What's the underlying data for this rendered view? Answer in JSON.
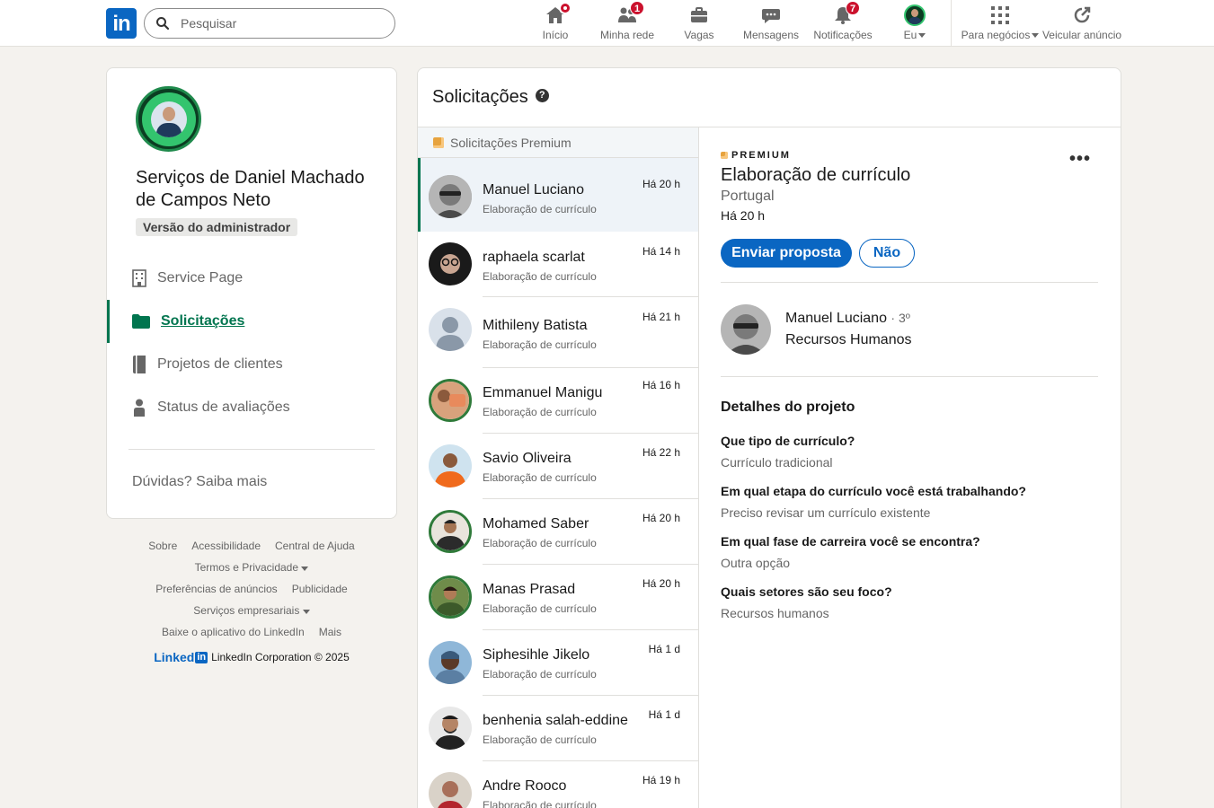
{
  "nav": {
    "search_placeholder": "Pesquisar",
    "items": [
      {
        "label": "Início",
        "icon": "home-icon",
        "badge": ""
      },
      {
        "label": "Minha rede",
        "icon": "network-icon",
        "badge": "1"
      },
      {
        "label": "Vagas",
        "icon": "briefcase-icon",
        "badge": ""
      },
      {
        "label": "Mensagens",
        "icon": "messaging-icon",
        "badge": ""
      },
      {
        "label": "Notificações",
        "icon": "bell-icon",
        "badge": "7"
      },
      {
        "label": "Eu",
        "icon": "avatar-icon",
        "badge": ""
      },
      {
        "label": "Para negócios",
        "icon": "grid-icon",
        "badge": ""
      },
      {
        "label": "Veicular anúncio",
        "icon": "ad-icon",
        "badge": ""
      }
    ],
    "logo_text": "in"
  },
  "sidebar": {
    "company_name": "Serviços de Daniel Machado de Campos Neto",
    "admin_tag": "Versão do administrador",
    "items": [
      {
        "label": "Service Page",
        "icon": "building-icon"
      },
      {
        "label": "Solicitações",
        "icon": "folder-icon"
      },
      {
        "label": "Projetos de clientes",
        "icon": "book-icon"
      },
      {
        "label": "Status de avaliações",
        "icon": "person-icon"
      }
    ],
    "help_link": "Dúvidas? Saiba mais"
  },
  "footer": {
    "links": [
      "Sobre",
      "Acessibilidade",
      "Central de Ajuda",
      "Termos e Privacidade",
      "Preferências de anúncios",
      "Publicidade",
      "Serviços empresariais",
      "Baixe o aplicativo do LinkedIn",
      "Mais"
    ],
    "brand": "Linked",
    "brand_in": "in",
    "copyright": "LinkedIn Corporation © 2025"
  },
  "main": {
    "title": "Solicitações",
    "help_glyph": "?",
    "premium_header": "Solicitações Premium",
    "requests": [
      {
        "name": "Manuel Luciano",
        "sub": "Elaboração de currículo",
        "time": "Há 20 h"
      },
      {
        "name": "raphaela scarlat",
        "sub": "Elaboração de currículo",
        "time": "Há 14 h"
      },
      {
        "name": "Mithileny Batista",
        "sub": "Elaboração de currículo",
        "time": "Há 21 h"
      },
      {
        "name": "Emmanuel Manigu",
        "sub": "Elaboração de currículo",
        "time": "Há 16 h"
      },
      {
        "name": "Savio Oliveira",
        "sub": "Elaboração de currículo",
        "time": "Há 22 h"
      },
      {
        "name": "Mohamed Saber",
        "sub": "Elaboração de currículo",
        "time": "Há 20 h"
      },
      {
        "name": "Manas Prasad",
        "sub": "Elaboração de currículo",
        "time": "Há 20 h"
      },
      {
        "name": "Siphesihle Jikelo",
        "sub": "Elaboração de currículo",
        "time": "Há 1 d"
      },
      {
        "name": "benhenia salah-eddine",
        "sub": "Elaboração de currículo",
        "time": "Há 1 d"
      },
      {
        "name": "Andre Rooco",
        "sub": "Elaboração de currículo",
        "time": "Há 19 h"
      }
    ]
  },
  "detail": {
    "premium_label": "PREMIUM",
    "more_glyph": "•••",
    "title": "Elaboração de currículo",
    "location": "Portugal",
    "time": "Há 20 h",
    "send_button": "Enviar proposta",
    "decline_button": "Não",
    "client_name": "Manuel Luciano",
    "client_degree": "· 3º",
    "client_role": "Recursos Humanos",
    "project_title": "Detalhes do projeto",
    "questions": [
      {
        "q": "Que tipo de currículo?",
        "a": "Currículo tradicional"
      },
      {
        "q": "Em qual etapa do currículo você está trabalhando?",
        "a": "Preciso revisar um currículo existente"
      },
      {
        "q": "Em qual fase de carreira você se encontra?",
        "a": "Outra opção"
      },
      {
        "q": "Quais setores são seu foco?",
        "a": "Recursos humanos"
      }
    ]
  },
  "colors": {
    "brand_blue": "#0a66c2",
    "active_green": "#01754f",
    "badge_red": "#cb112d",
    "premium_gold": "#e7a33e"
  }
}
